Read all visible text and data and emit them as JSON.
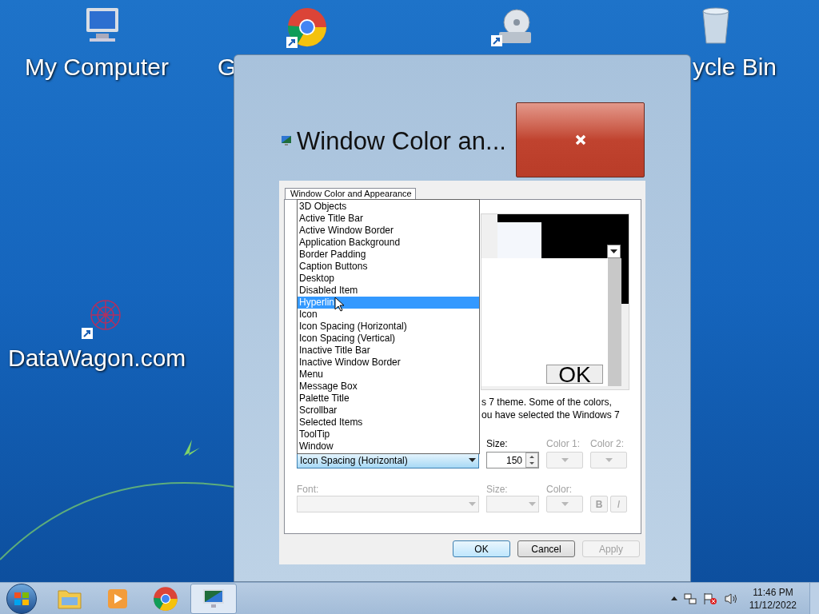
{
  "desktop_icons": [
    {
      "kind": "computer",
      "label": "My Computer"
    },
    {
      "kind": "chrome",
      "label": "G"
    },
    {
      "kind": "disc"
    },
    {
      "kind": "recycle",
      "label": "ycle Bin"
    },
    {
      "kind": "flower",
      "label": "DataWagon.com"
    }
  ],
  "window": {
    "title": "Window Color an...",
    "tab": "Window Color and Appearance",
    "preview": {
      "ok_label": "OK"
    },
    "description_lines": [
      "s 7 theme.  Some of the colors,",
      "ou have selected the Windows 7"
    ],
    "item_list": [
      {
        "label": "3D Objects",
        "selected": false
      },
      {
        "label": "Active Title Bar",
        "selected": false
      },
      {
        "label": "Active Window Border",
        "selected": false
      },
      {
        "label": "Application Background",
        "selected": false
      },
      {
        "label": "Border Padding",
        "selected": false
      },
      {
        "label": "Caption Buttons",
        "selected": false
      },
      {
        "label": "Desktop",
        "selected": false
      },
      {
        "label": "Disabled Item",
        "selected": false
      },
      {
        "label": "Hyperlin",
        "selected": true
      },
      {
        "label": "Icon",
        "selected": false
      },
      {
        "label": "Icon Spacing (Horizontal)",
        "selected": false
      },
      {
        "label": "Icon Spacing (Vertical)",
        "selected": false
      },
      {
        "label": "Inactive Title Bar",
        "selected": false
      },
      {
        "label": "Inactive Window Border",
        "selected": false
      },
      {
        "label": "Menu",
        "selected": false
      },
      {
        "label": "Message Box",
        "selected": false
      },
      {
        "label": "Palette Title",
        "selected": false
      },
      {
        "label": "Scrollbar",
        "selected": false
      },
      {
        "label": "Selected Items",
        "selected": false
      },
      {
        "label": "ToolTip",
        "selected": false
      },
      {
        "label": "Window",
        "selected": false
      }
    ],
    "item_value": "Icon Spacing (Horizontal)",
    "size": {
      "label": "Size:",
      "value": "150",
      "disabled": false
    },
    "color1": {
      "label": "Color 1:",
      "disabled": true
    },
    "color2": {
      "label": "Color 2:",
      "disabled": true
    },
    "font": {
      "label": "Font:",
      "disabled": true
    },
    "font_size": {
      "label": "Size:",
      "disabled": true
    },
    "font_color": {
      "label": "Color:",
      "disabled": true
    },
    "bold": {
      "label": "B",
      "disabled": true
    },
    "italic": {
      "label": "I",
      "disabled": true
    },
    "buttons": [
      {
        "label": "OK",
        "default": true,
        "disabled": false
      },
      {
        "label": "Cancel",
        "default": false,
        "disabled": false
      },
      {
        "label": "Apply",
        "default": false,
        "disabled": true
      }
    ]
  },
  "taskbar": {
    "apps": [
      {
        "kind": "folder",
        "selected": false
      },
      {
        "kind": "media",
        "selected": false
      },
      {
        "kind": "chrome",
        "selected": false
      },
      {
        "kind": "display",
        "selected": true
      }
    ],
    "time": "11:46 PM",
    "date": "11/12/2022"
  }
}
